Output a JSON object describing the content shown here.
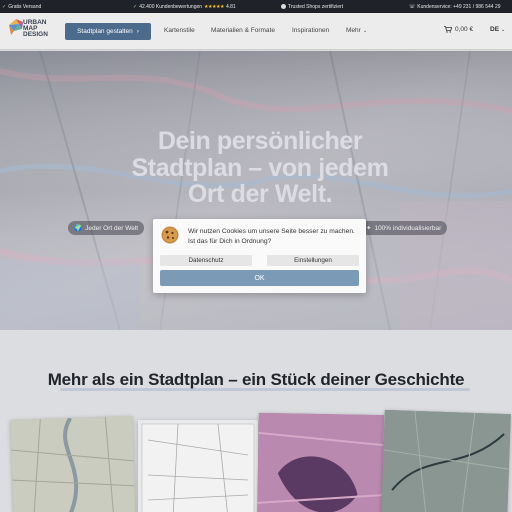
{
  "topbar": {
    "shipping": "Gratis Versand",
    "reviews_text": "42.400 Kundenbewertungen",
    "stars": "★★★★★",
    "rating": "4.81",
    "trusted": "Trusted Shops zertifiziert",
    "service": "Kundenservice: +49 231 / 986 544 29"
  },
  "header": {
    "logo_lines": [
      "URBAN",
      "MAP",
      "DESIGN"
    ],
    "cta_label": "Stadtplan gestalten",
    "nav": [
      "Kartenstile",
      "Materialien & Formate",
      "Inspirationen",
      "Mehr"
    ],
    "cart_total": "0,00 €",
    "language": "DE"
  },
  "hero": {
    "title": "Dein persönlicher Stadtplan – von jedem Ort der Welt.",
    "chips": [
      "Jeder Ort der Welt",
      "100% individualisierbar"
    ]
  },
  "cookie": {
    "message": "Wir nutzen Cookies um unsere Seite besser zu machen. Ist das für Dich in Ordnung?",
    "privacy_label": "Datenschutz",
    "settings_label": "Einstellungen",
    "ok_label": "OK"
  },
  "section2": {
    "title": "Mehr als ein Stadtplan – ein Stück deiner Geschichte"
  },
  "colors": {
    "cta": "#4b6a8c",
    "ok_button": "#7b9ab6",
    "topbar": "#1f2229"
  }
}
